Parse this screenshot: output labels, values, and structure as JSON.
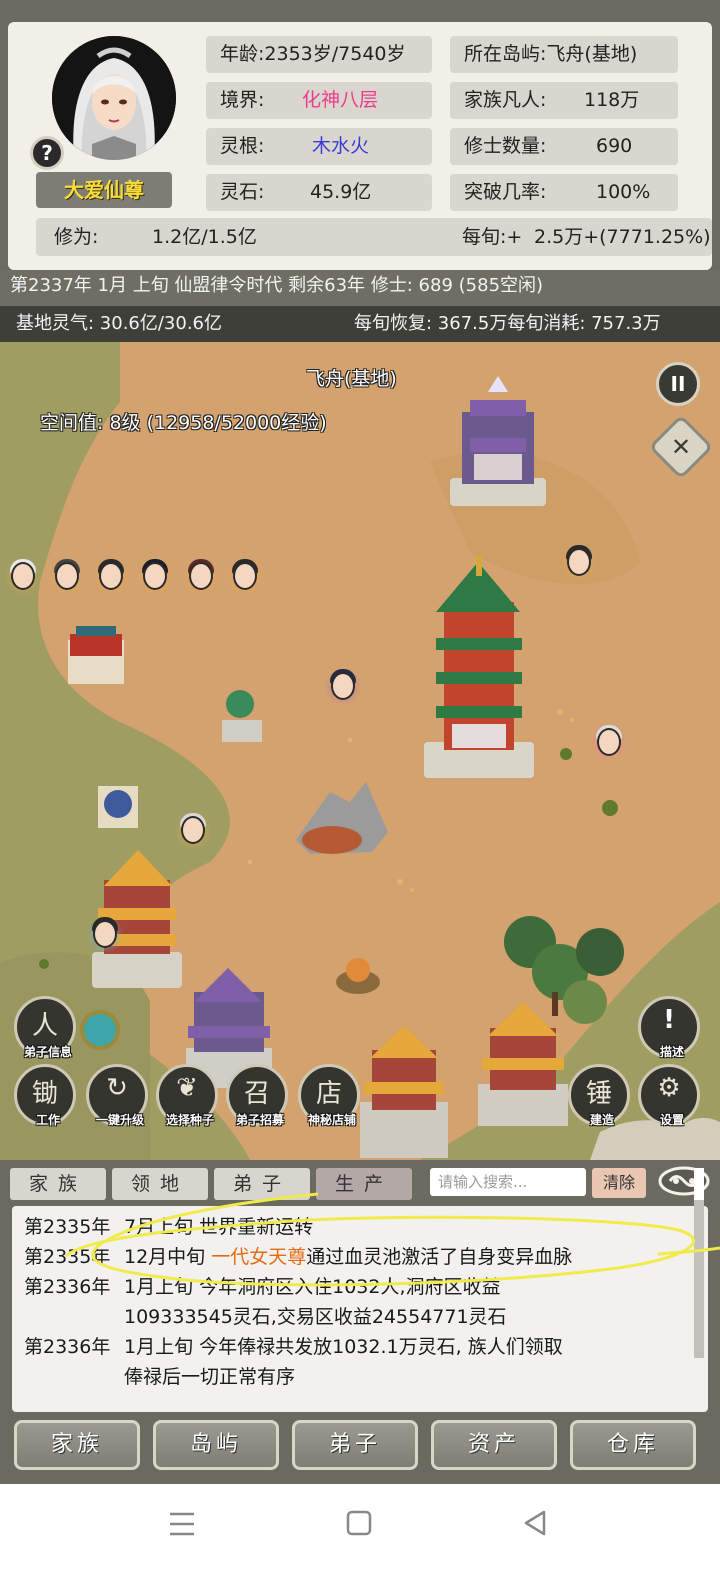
{
  "player": {
    "name": "大爱仙尊",
    "help_glyph": "?"
  },
  "stats": {
    "age": {
      "label": "年龄:",
      "value": "2353岁/7540岁"
    },
    "realm": {
      "label": "境界:",
      "value": "化神八层",
      "color": "#ee3a8c"
    },
    "root": {
      "label": "灵根:",
      "value": "木水火",
      "color": "#3b3bd6"
    },
    "stones": {
      "label": "灵石:",
      "value": "45.9亿"
    },
    "island": {
      "label": "所在岛屿:",
      "value": "飞舟(基地)"
    },
    "mortals": {
      "label": "家族凡人:",
      "value": "118万"
    },
    "cultivators": {
      "label": "修士数量:",
      "value": "690"
    },
    "breakthrough": {
      "label": "突破几率:",
      "value": "100%"
    },
    "cultivation": {
      "label": "修为:",
      "value": "1.2亿/1.5亿"
    },
    "per_xun": {
      "label": "每旬:+",
      "value": "2.5万+(7771.25%)"
    }
  },
  "status_line": "第2337年 1月 上旬  仙盟律令时代 剩余63年  修士: 689 (585空闲)",
  "qi": {
    "base": "基地灵气: 30.6亿/30.6亿",
    "flow": "每旬恢复: 367.5万每旬消耗: 757.3万"
  },
  "map": {
    "location_title": "飞舟(基地)",
    "space_level": "空间值: 8级 (12958/52000经验)",
    "pause_glyph": "II",
    "close_glyph": "✕",
    "colors": {
      "sand": "#d3a26e",
      "grass": "#a09d62"
    },
    "actions": [
      {
        "id": "disciple-info",
        "label": "弟子信息",
        "glyph": "人"
      },
      {
        "id": "work",
        "label": "工作",
        "glyph": "锄"
      },
      {
        "id": "one-click-upgrade",
        "label": "一键升级",
        "glyph": "↻"
      },
      {
        "id": "select-seed",
        "label": "选择种子",
        "glyph": "❦"
      },
      {
        "id": "recruit",
        "label": "弟子招募",
        "glyph": "召"
      },
      {
        "id": "mystery-shop",
        "label": "神秘店铺",
        "glyph": "店"
      },
      {
        "id": "describe",
        "label": "描述",
        "glyph": "!"
      },
      {
        "id": "build",
        "label": "建造",
        "glyph": "锤"
      },
      {
        "id": "settings",
        "label": "设置",
        "glyph": "⚙"
      }
    ]
  },
  "log_tabs": [
    "家族",
    "领地",
    "弟子",
    "生产"
  ],
  "search": {
    "placeholder": "请输入搜索...",
    "clear_label": "清除"
  },
  "log": [
    {
      "date": "第2335年",
      "text_a": "7月上旬 世界重新运转"
    },
    {
      "date": "第2335年",
      "text_a": "12月中旬 ",
      "highlight": "一代女天尊",
      "text_b": "通过血灵池激活了自身变异血脉"
    },
    {
      "date": "第2336年",
      "text_a": "1月上旬 今年洞府区入住1032人,洞府区收益",
      "cont": "109333545灵石,交易区收益24554771灵石"
    },
    {
      "date": "第2336年",
      "text_a": "1月上旬 今年俸禄共发放1032.1万灵石, 族人们领取",
      "cont": "俸禄后一切正常有序"
    }
  ],
  "bottom_nav": [
    "家族",
    "岛屿",
    "弟子",
    "资产",
    "仓库"
  ]
}
